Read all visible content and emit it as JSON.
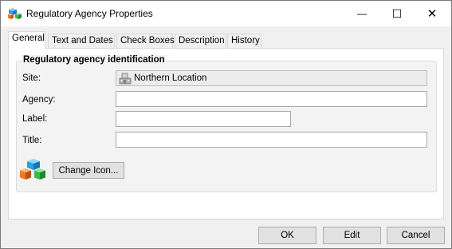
{
  "window": {
    "title": "Regulatory Agency Properties",
    "minimize_glyph": "—",
    "maximize_glyph": "☐",
    "close_glyph": "✕"
  },
  "tabs": [
    {
      "label": "General",
      "active": true
    },
    {
      "label": "Text and Dates",
      "active": false
    },
    {
      "label": "Check Boxes",
      "active": false
    },
    {
      "label": "Description",
      "active": false
    },
    {
      "label": "History",
      "active": false
    }
  ],
  "group": {
    "legend": "Regulatory agency identification",
    "site_label": "Site:",
    "site_value": "Northern Location",
    "agency_label": "Agency:",
    "agency_value": "",
    "label_label": "Label:",
    "label_value": "",
    "title_label": "Title:",
    "title_value": "",
    "change_icon_button": "Change Icon..."
  },
  "footer": {
    "ok": "OK",
    "edit": "Edit",
    "cancel": "Cancel"
  },
  "colors": {
    "cube_orange": "#f07828",
    "cube_blue": "#2aa0e0",
    "cube_green": "#3cb84a"
  },
  "icons": {
    "app": "cubes-icon",
    "site": "building-icon",
    "agency": "cubes-icon"
  }
}
